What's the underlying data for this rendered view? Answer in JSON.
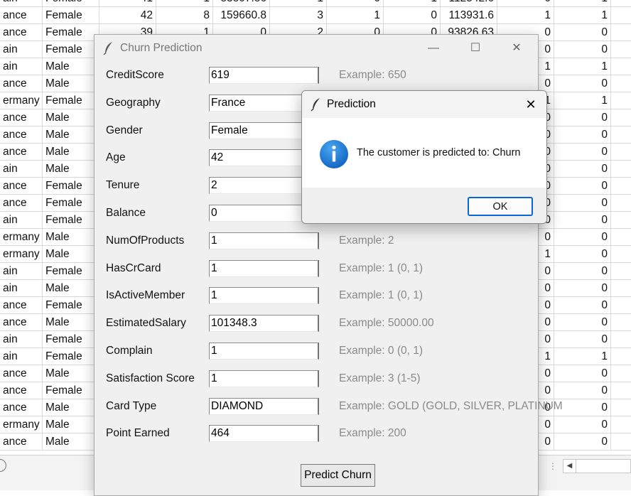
{
  "sheet": {
    "rows": [
      [
        "ain",
        "Female",
        "41",
        "1",
        "83807.86",
        "1",
        "0",
        "1",
        "112542.6",
        "0",
        "1"
      ],
      [
        "ance",
        "Female",
        "42",
        "8",
        "159660.8",
        "3",
        "1",
        "0",
        "113931.6",
        "1",
        "1"
      ],
      [
        "ance",
        "Female",
        "39",
        "1",
        "0",
        "2",
        "0",
        "0",
        "93826.63",
        "0",
        "0"
      ],
      [
        "ain",
        "Female",
        "",
        "",
        "",
        "",
        "",
        "",
        "",
        "0",
        "0"
      ],
      [
        "ain",
        "Male",
        "",
        "",
        "",
        "",
        "",
        "",
        "",
        "1",
        "1"
      ],
      [
        "ance",
        "Male",
        "",
        "",
        "",
        "",
        "",
        "",
        "",
        "0",
        "0"
      ],
      [
        "ermany",
        "Female",
        "",
        "",
        "",
        "",
        "",
        "",
        "",
        "1",
        "1"
      ],
      [
        "ance",
        "Male",
        "",
        "",
        "",
        "",
        "",
        "",
        "",
        "0",
        "0"
      ],
      [
        "ance",
        "Male",
        "",
        "",
        "",
        "",
        "",
        "",
        "",
        "0",
        "0"
      ],
      [
        "ance",
        "Male",
        "",
        "",
        "",
        "",
        "",
        "",
        "",
        "0",
        "0"
      ],
      [
        "ain",
        "Male",
        "",
        "",
        "",
        "",
        "",
        "",
        "",
        "0",
        "0"
      ],
      [
        "ance",
        "Female",
        "",
        "",
        "",
        "",
        "",
        "",
        "",
        "0",
        "0"
      ],
      [
        "ance",
        "Female",
        "",
        "",
        "",
        "",
        "",
        "",
        "",
        "0",
        "0"
      ],
      [
        "ain",
        "Female",
        "",
        "",
        "",
        "",
        "",
        "",
        "",
        "0",
        "0"
      ],
      [
        "ermany",
        "Male",
        "",
        "",
        "",
        "",
        "",
        "",
        "",
        "0",
        "0"
      ],
      [
        "ermany",
        "Male",
        "",
        "",
        "",
        "",
        "",
        "",
        "",
        "1",
        "0"
      ],
      [
        "ain",
        "Female",
        "",
        "",
        "",
        "",
        "",
        "",
        "",
        "0",
        "0"
      ],
      [
        "ain",
        "Male",
        "",
        "",
        "",
        "",
        "",
        "",
        "",
        "0",
        "0"
      ],
      [
        "ance",
        "Female",
        "",
        "",
        "",
        "",
        "",
        "",
        "",
        "0",
        "0"
      ],
      [
        "ance",
        "Male",
        "",
        "",
        "",
        "",
        "",
        "",
        "",
        "0",
        "0"
      ],
      [
        "ain",
        "Female",
        "",
        "",
        "",
        "",
        "",
        "",
        "",
        "0",
        "0"
      ],
      [
        "ain",
        "Female",
        "",
        "",
        "",
        "",
        "",
        "",
        "",
        "1",
        "1"
      ],
      [
        "ance",
        "Male",
        "",
        "",
        "",
        "",
        "",
        "",
        "",
        "0",
        "0"
      ],
      [
        "ance",
        "Female",
        "",
        "",
        "",
        "",
        "",
        "",
        "",
        "0",
        "0"
      ],
      [
        "ance",
        "Male",
        "",
        "",
        "",
        "",
        "",
        "",
        "",
        "0",
        "0"
      ],
      [
        "ermany",
        "Male",
        "",
        "",
        "",
        "",
        "",
        "",
        "",
        "0",
        "0"
      ],
      [
        "ance",
        "Male",
        "",
        "",
        "",
        "",
        "",
        "",
        "",
        "0",
        "0"
      ]
    ]
  },
  "main_window": {
    "title": "Churn Prediction",
    "icon": "feather-icon",
    "controls": {
      "minimize": "—",
      "maximize": "☐",
      "close": "✕"
    },
    "fields": [
      {
        "label": "CreditScore",
        "value": "619",
        "example": "Example: 650"
      },
      {
        "label": "Geography",
        "value": "France",
        "example": ""
      },
      {
        "label": "Gender",
        "value": "Female",
        "example": ""
      },
      {
        "label": "Age",
        "value": "42",
        "example": ""
      },
      {
        "label": "Tenure",
        "value": "2",
        "example": ""
      },
      {
        "label": "Balance",
        "value": "0",
        "example": ""
      },
      {
        "label": "NumOfProducts",
        "value": "1",
        "example": "Example: 2"
      },
      {
        "label": "HasCrCard",
        "value": "1",
        "example": "Example: 1 (0, 1)"
      },
      {
        "label": "IsActiveMember",
        "value": "1",
        "example": "Example: 1 (0, 1)"
      },
      {
        "label": "EstimatedSalary",
        "value": "101348.3",
        "example": "Example: 50000.00"
      },
      {
        "label": "Complain",
        "value": "1",
        "example": "Example: 0 (0, 1)"
      },
      {
        "label": "Satisfaction Score",
        "value": "1",
        "example": "Example: 3 (1-5)"
      },
      {
        "label": "Card Type",
        "value": "DIAMOND",
        "example": "Example: GOLD (GOLD, SILVER, PLATINUM"
      },
      {
        "label": "Point Earned",
        "value": "464",
        "example": "Example: 200"
      }
    ],
    "predict_button": "Predict Churn"
  },
  "dialog": {
    "title": "Prediction",
    "close": "✕",
    "icon": "info-icon",
    "message": "The customer is predicted to: Churn",
    "ok_label": "OK"
  },
  "colors": {
    "accent": "#0a66d8",
    "info_blue": "#1b7fd8"
  }
}
